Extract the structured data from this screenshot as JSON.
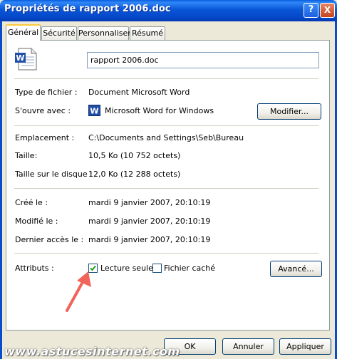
{
  "window": {
    "title": "Propriétés de rapport 2006.doc",
    "help_button": "?",
    "close_button": "X"
  },
  "tabs": [
    "Général",
    "Sécurité",
    "Personnaliser",
    "Résumé"
  ],
  "file": {
    "name": "rapport 2006.doc",
    "icon": "word-document-icon"
  },
  "fields": {
    "type_label": "Type de fichier :",
    "type_value": "Document Microsoft Word",
    "opens_label": "S'ouvre avec :",
    "opens_value": "Microsoft Word for Windows",
    "change_button": "Modifier...",
    "location_label": "Emplacement :",
    "location_value": "C:\\Documents and Settings\\Seb\\Bureau",
    "size_label": "Taille:",
    "size_value": "10,5 Ko (10 752 octets)",
    "disk_size_label": "Taille sur le disque :",
    "disk_size_value": "12,0 Ko (12 288 octets)",
    "created_label": "Créé le :",
    "created_value": "mardi 9 janvier 2007, 20:10:19",
    "modified_label": "Modifié le :",
    "modified_value": "mardi 9 janvier 2007, 20:10:19",
    "accessed_label": "Dernier accès le :",
    "accessed_value": "mardi 9 janvier 2007, 20:10:19"
  },
  "attributes": {
    "label": "Attributs :",
    "readonly_label": "Lecture seule",
    "readonly_checked": true,
    "hidden_label": "Fichier caché",
    "hidden_checked": false,
    "advanced_button": "Avancé..."
  },
  "buttons": {
    "ok": "OK",
    "cancel": "Annuler",
    "apply": "Appliquer"
  },
  "watermark": "www.astucesinternet.com",
  "colors": {
    "titlebar": "#0A5FE0",
    "annotation_arrow": "#F0645A",
    "active_tab_accent": "#FFC83C"
  }
}
